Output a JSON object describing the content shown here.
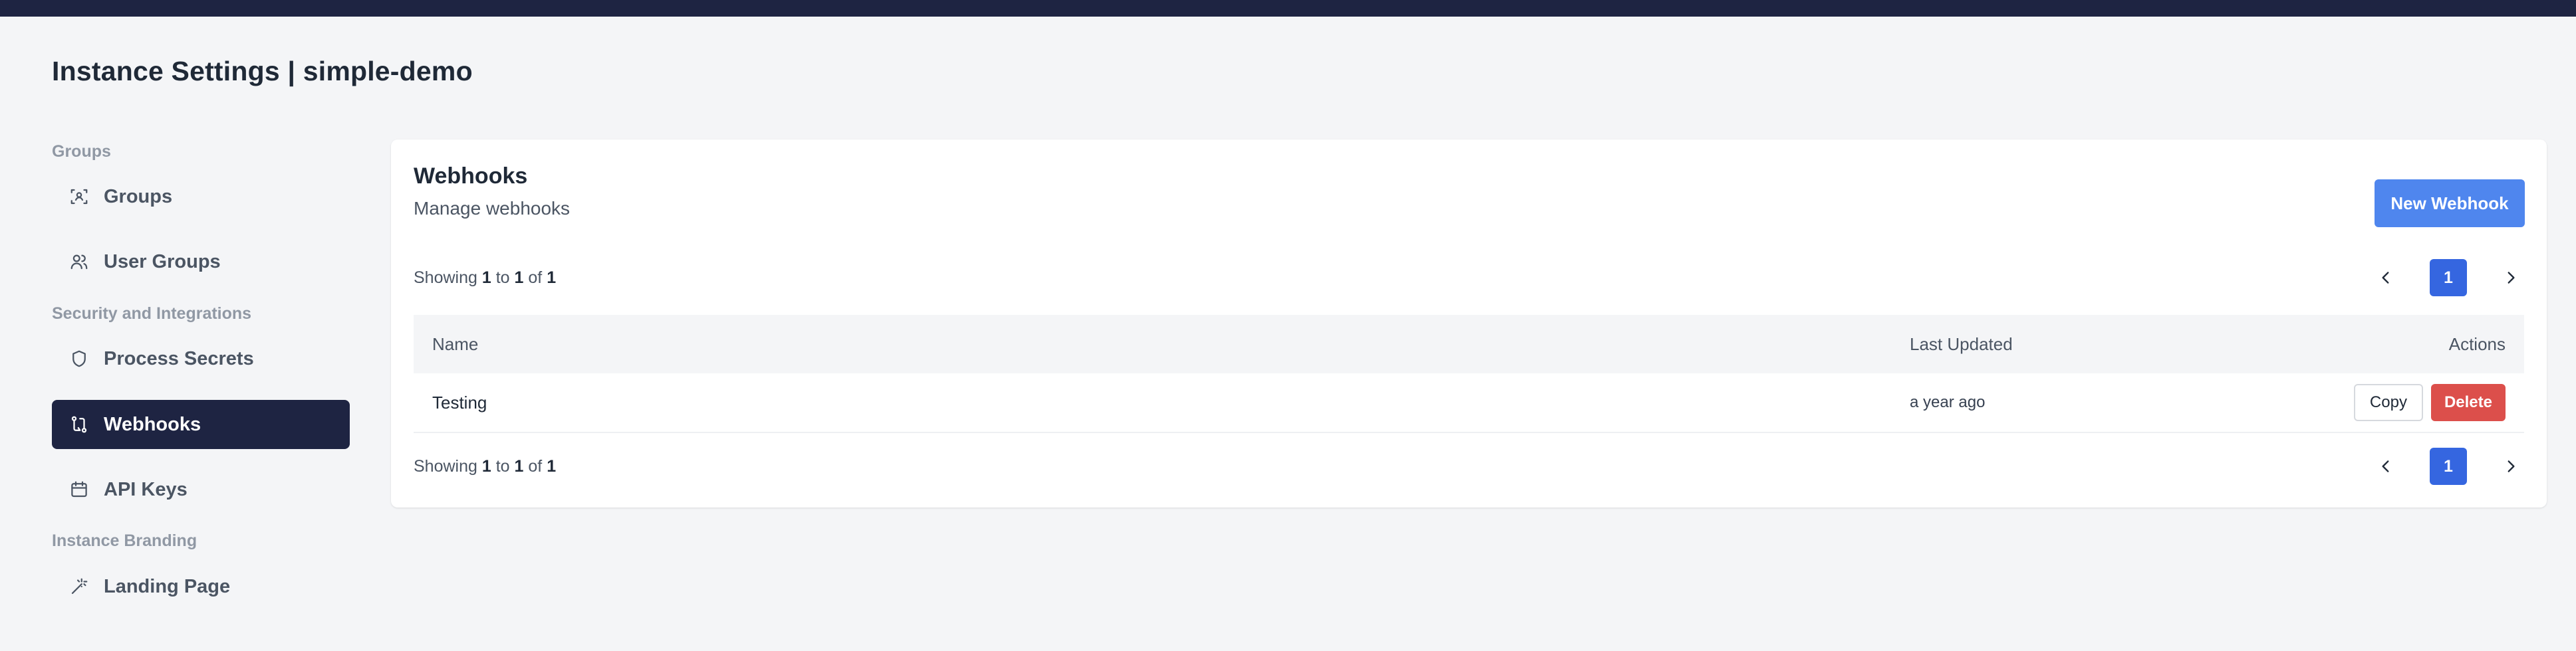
{
  "page": {
    "title": "Instance Settings | simple-demo"
  },
  "colors": {
    "topbar": "#1e2442",
    "primary": "#4f86ee",
    "page_active": "#3566e0",
    "danger": "#dc4f4b"
  },
  "sidebar": {
    "sections": [
      {
        "label": "Groups"
      },
      {
        "label": "Security and Integrations"
      },
      {
        "label": "Instance Branding"
      }
    ],
    "items": [
      {
        "label": "Groups",
        "icon": "groups-icon"
      },
      {
        "label": "User Groups",
        "icon": "users-icon"
      },
      {
        "label": "Process Secrets",
        "icon": "shield-icon"
      },
      {
        "label": "Webhooks",
        "icon": "webhook-icon",
        "active": true
      },
      {
        "label": "API Keys",
        "icon": "calendar-key-icon"
      },
      {
        "label": "Landing Page",
        "icon": "magic-wand-icon"
      }
    ]
  },
  "webhooks": {
    "title": "Webhooks",
    "subtitle": "Manage webhooks",
    "new_button": "New Webhook",
    "showing": {
      "prefix": "Showing",
      "from": "1",
      "to_word": "to",
      "to": "1",
      "of_word": "of",
      "total": "1"
    },
    "current_page": "1",
    "columns": {
      "name": "Name",
      "updated": "Last Updated",
      "actions": "Actions"
    },
    "rows": [
      {
        "name": "Testing",
        "updated": "a year ago",
        "copy": "Copy",
        "delete": "Delete"
      }
    ]
  }
}
